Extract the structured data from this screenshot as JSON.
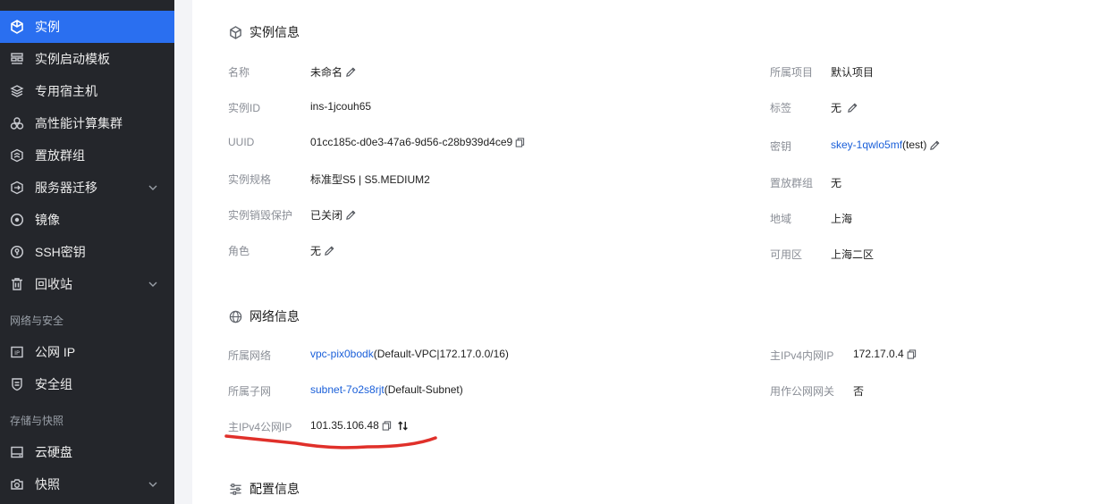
{
  "sidebar": {
    "items": [
      {
        "label": "实例",
        "icon": "cube-icon",
        "active": true
      },
      {
        "label": "实例启动模板",
        "icon": "template-icon"
      },
      {
        "label": "专用宿主机",
        "icon": "layers-icon"
      },
      {
        "label": "高性能计算集群",
        "icon": "cluster-icon"
      },
      {
        "label": "置放群组",
        "icon": "placement-group-icon"
      },
      {
        "label": "服务器迁移",
        "icon": "migrate-icon",
        "expandable": true
      },
      {
        "label": "镜像",
        "icon": "disc-icon"
      },
      {
        "label": "SSH密钥",
        "icon": "key-icon"
      },
      {
        "label": "回收站",
        "icon": "trash-icon",
        "expandable": true
      },
      {
        "label": "公网 IP",
        "icon": "ip-icon"
      },
      {
        "label": "安全组",
        "icon": "shield-icon"
      },
      {
        "label": "云硬盘",
        "icon": "disk-icon"
      },
      {
        "label": "快照",
        "icon": "camera-icon",
        "expandable": true
      }
    ],
    "groups": [
      "网络与安全",
      "存储与快照"
    ]
  },
  "instance_info": {
    "title": "实例信息",
    "left": [
      {
        "label": "名称",
        "value": "未命名"
      },
      {
        "label": "实例ID",
        "value": "ins-1jcouh65"
      },
      {
        "label": "UUID",
        "value": "01cc185c-d0e3-47a6-9d56-c28b939d4ce9"
      },
      {
        "label": "实例规格",
        "value": "标准型S5 | S5.MEDIUM2"
      },
      {
        "label": "实例销毁保护",
        "value": "已关闭"
      },
      {
        "label": "角色",
        "value": "无"
      }
    ],
    "right": [
      {
        "label": "所属项目",
        "value": "默认项目"
      },
      {
        "label": "标签",
        "value": "无"
      },
      {
        "label": "密钥",
        "link": "skey-1qwlo5mf",
        "value": "(test)"
      },
      {
        "label": "置放群组",
        "value": "无"
      },
      {
        "label": "地域",
        "value": "上海"
      },
      {
        "label": "可用区",
        "value": "上海二区"
      }
    ]
  },
  "network_info": {
    "title": "网络信息",
    "left": [
      {
        "label": "所属网络",
        "link": "vpc-pix0bodk",
        "value": "(Default-VPC|172.17.0.0/16)"
      },
      {
        "label": "所属子网",
        "link": "subnet-7o2s8rjt",
        "value": "(Default-Subnet)"
      },
      {
        "label": "主IPv4公网IP",
        "value": "101.35.106.48"
      }
    ],
    "right": [
      {
        "label": "主IPv4内网IP",
        "value": "172.17.0.4"
      },
      {
        "label": "用作公网网关",
        "value": "否"
      }
    ]
  },
  "config_info": {
    "title": "配置信息"
  },
  "colors": {
    "sidebar_bg": "#24262b",
    "active": "#2a6ff0",
    "link": "#1a5fd9",
    "annotation": "#e0302a"
  }
}
